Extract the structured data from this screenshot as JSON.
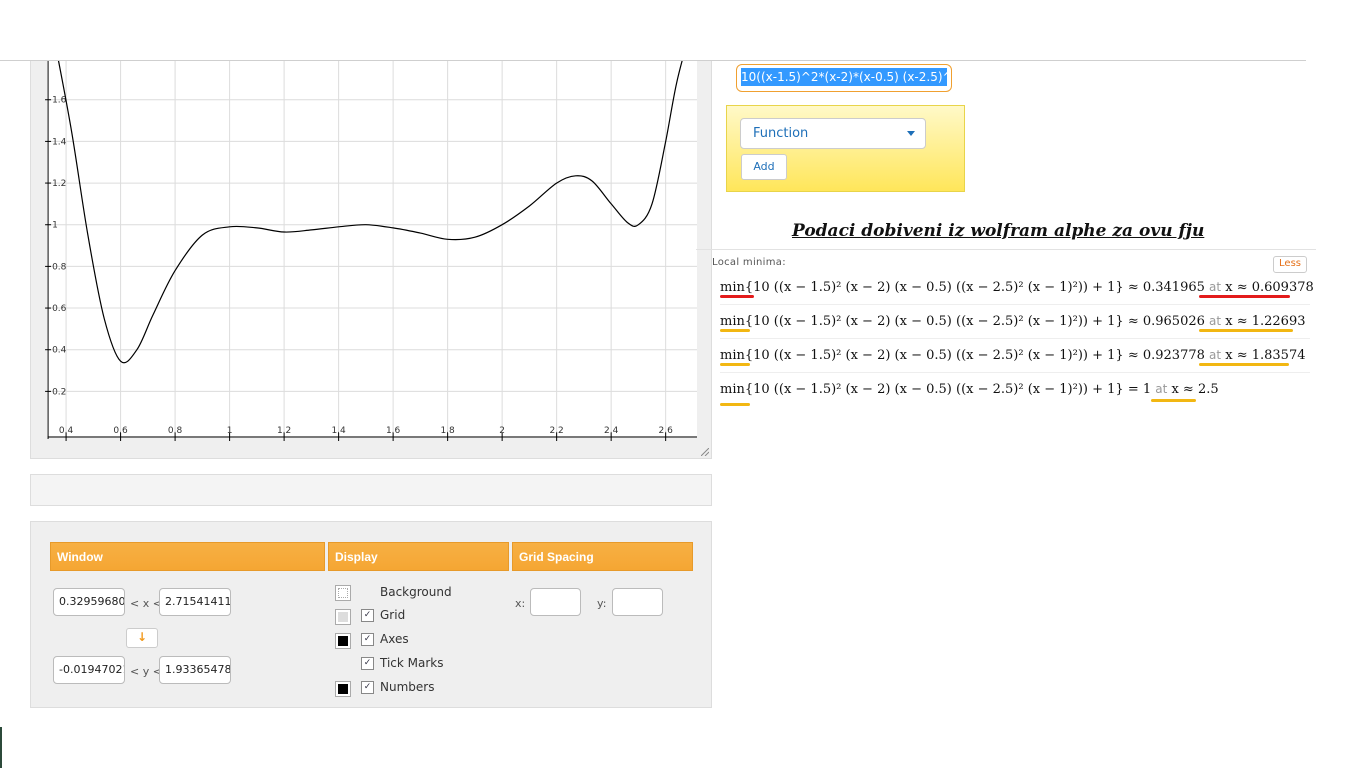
{
  "graph": {
    "x_ticks": [
      "0.4",
      "0.6",
      "0.8",
      "1",
      "1.2",
      "1.4",
      "1.6",
      "1.8",
      "2",
      "2.2",
      "2.4",
      "2.6"
    ],
    "y_ticks": [
      "1.8",
      "1.6",
      "1.4",
      "1.2",
      "1",
      "0.8",
      "0.6",
      "0.4",
      "0.2"
    ]
  },
  "chart_data": {
    "type": "line",
    "xlim": [
      0.33,
      2.715
    ],
    "ylim": [
      -0.019,
      1.93
    ],
    "grid": true,
    "series": [
      {
        "x": [
          0.36,
          0.42,
          0.48,
          0.54,
          0.6,
          0.66,
          0.72,
          0.8,
          0.9,
          1.0,
          1.1,
          1.2,
          1.3,
          1.4,
          1.5,
          1.6,
          1.7,
          1.8,
          1.9,
          2.0,
          2.1,
          2.2,
          2.27,
          2.33,
          2.4,
          2.46,
          2.5,
          2.55,
          2.6,
          2.64,
          2.68
        ],
        "y": [
          1.87,
          1.45,
          0.95,
          0.55,
          0.345,
          0.4,
          0.57,
          0.78,
          0.95,
          0.99,
          0.985,
          0.965,
          0.975,
          0.99,
          1.0,
          0.985,
          0.96,
          0.93,
          0.94,
          1.0,
          1.09,
          1.2,
          1.235,
          1.21,
          1.1,
          1.01,
          1.0,
          1.1,
          1.4,
          1.68,
          1.88
        ]
      }
    ]
  },
  "function_input": {
    "value": "10((x-1.5)^2*(x-2)*(x-0.5) (x-2.5)^",
    "type_label": "Function",
    "add_label": "Add"
  },
  "caption": "Podaci dobiveni iz wolfram alphe za ovu fju",
  "wolfram": {
    "title": "Local minima:",
    "less_label": "Less",
    "expression": "min{10 ((x − 1.5)² (x − 2) (x − 0.5) ((x − 2.5)² (x − 1)²)) + 1}",
    "rows": [
      {
        "value": "≈ 0.341965",
        "at": "at",
        "x": "x ≈ 0.609378"
      },
      {
        "value": "≈ 0.965026",
        "at": "at",
        "x": "x ≈ 1.22693"
      },
      {
        "value": "≈ 0.923778",
        "at": "at",
        "x": "x ≈ 1.83574"
      },
      {
        "value": "= 1",
        "at": "at",
        "x": "x ≈ 2.5"
      }
    ],
    "colors": {
      "red": "#e31b1b",
      "yellow": "#f2b712"
    }
  },
  "settings": {
    "window_label": "Window",
    "display_label": "Display",
    "grid_spacing_label": "Grid Spacing",
    "xmin": "0.32959680",
    "xmax": "2.71541411",
    "ymin": "-0.01947021",
    "ymax": "1.93365478",
    "lt": "< x <",
    "lty": "< y <",
    "swap": "↓",
    "background_label": "Background",
    "grid_label": "Grid",
    "axes_label": "Axes",
    "tickmarks_label": "Tick Marks",
    "numbers_label": "Numbers",
    "x_label": "x:",
    "y_label": "y:",
    "grid_x": "",
    "grid_y": ""
  }
}
